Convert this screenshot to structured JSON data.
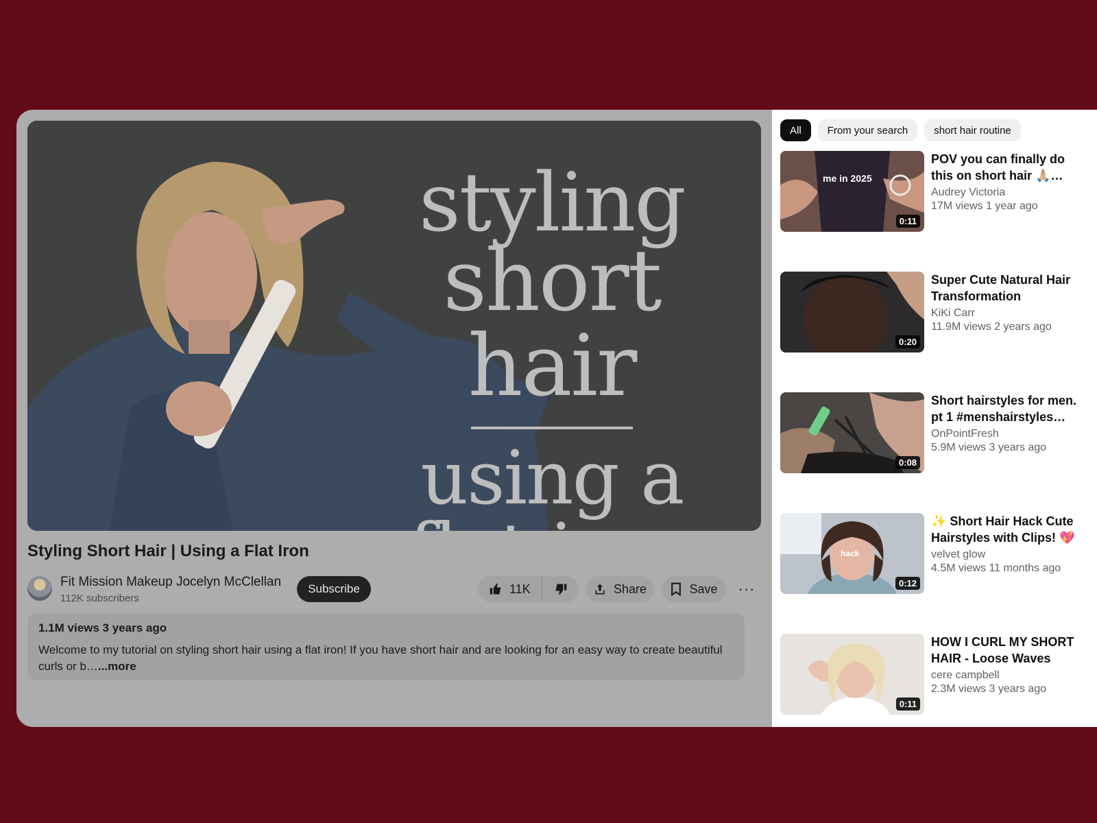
{
  "video": {
    "thumbnail_lines": [
      "styling",
      "short hair",
      "using a",
      "flat iron"
    ],
    "title": "Styling Short Hair | Using a Flat Iron",
    "channel": "Fit Mission Makeup Jocelyn McClellan",
    "subscribers": "112K subscribers",
    "subscribe_label": "Subscribe",
    "likes": "11K",
    "share_label": "Share",
    "save_label": "Save",
    "more_label": "···",
    "description": {
      "meta": "1.1M views 3 years ago",
      "text": "Welcome to my tutorial on styling short hair using a flat iron! If you have short hair and are looking for an easy way to create beautiful curls or b…",
      "more": "...more"
    }
  },
  "sidebar": {
    "chips": [
      {
        "label": "All"
      },
      {
        "label": "From your search"
      },
      {
        "label": "short hair routine"
      }
    ],
    "recommendations": [
      {
        "title": "POV you can finally do this on short hair 🙏🏼…",
        "channel": "Audrey Victoria",
        "meta": "17M views 1 year ago",
        "duration": "0:11",
        "overlay": "me in 2025"
      },
      {
        "title": "Super Cute Natural Hair Transformation",
        "channel": "KiKi Carr",
        "meta": "11.9M views 2 years ago",
        "duration": "0:20",
        "overlay": ""
      },
      {
        "title": "Short hairstyles for men. pt 1 #menshairstyles…",
        "channel": "OnPointFresh",
        "meta": "5.9M views 3 years ago",
        "duration": "0:08",
        "overlay": ""
      },
      {
        "title": "✨ Short Hair Hack Cute Hairstyles with Clips! 💖",
        "channel": "velvet glow",
        "meta": "4.5M views 11 months ago",
        "duration": "0:12",
        "overlay": "hack"
      },
      {
        "title": "HOW I CURL MY SHORT HAIR - Loose Waves",
        "channel": "cere campbell",
        "meta": "2.3M views 3 years ago",
        "duration": "0:11",
        "overlay": ""
      }
    ]
  },
  "icons": {
    "like": "thumbs-up-icon",
    "dislike": "thumbs-down-icon",
    "share": "share-icon",
    "save": "bookmark-icon",
    "more": "more-horizontal-icon"
  }
}
